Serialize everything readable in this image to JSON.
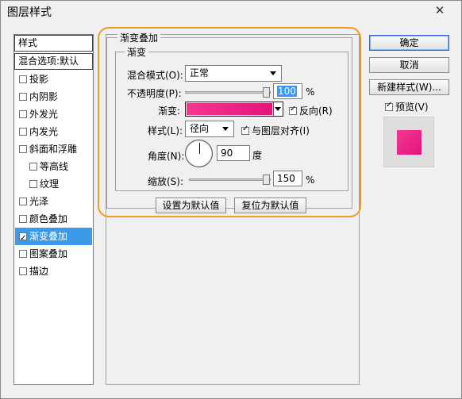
{
  "window": {
    "title": "图层样式",
    "close_glyph": "✕"
  },
  "sidebar": {
    "header": "样式",
    "blend_options": "混合选项:默认",
    "items": [
      {
        "label": "投影",
        "checked": false,
        "indent": false,
        "selected": false
      },
      {
        "label": "内阴影",
        "checked": false,
        "indent": false,
        "selected": false
      },
      {
        "label": "外发光",
        "checked": false,
        "indent": false,
        "selected": false
      },
      {
        "label": "内发光",
        "checked": false,
        "indent": false,
        "selected": false
      },
      {
        "label": "斜面和浮雕",
        "checked": false,
        "indent": false,
        "selected": false
      },
      {
        "label": "等高线",
        "checked": false,
        "indent": true,
        "selected": false
      },
      {
        "label": "纹理",
        "checked": false,
        "indent": true,
        "selected": false
      },
      {
        "label": "光泽",
        "checked": false,
        "indent": false,
        "selected": false
      },
      {
        "label": "颜色叠加",
        "checked": false,
        "indent": false,
        "selected": false
      },
      {
        "label": "渐变叠加",
        "checked": true,
        "indent": false,
        "selected": true
      },
      {
        "label": "图案叠加",
        "checked": false,
        "indent": false,
        "selected": false
      },
      {
        "label": "描边",
        "checked": false,
        "indent": false,
        "selected": false
      }
    ]
  },
  "panel": {
    "group_title": "渐变叠加",
    "subgroup_title": "渐变",
    "blend_mode_label": "混合模式(O):",
    "blend_mode_value": "正常",
    "opacity_label": "不透明度(P):",
    "opacity_value": "100",
    "opacity_fraction": 1.0,
    "percent": "%",
    "gradient_label": "渐变:",
    "reverse_label": "反向(R)",
    "reverse_checked": true,
    "style_label": "样式(L):",
    "style_value": "径向",
    "align_label": "与图层对齐(I)",
    "align_checked": true,
    "angle_label": "角度(N):",
    "angle_value": "90",
    "angle_unit": "度",
    "scale_label": "缩放(S):",
    "scale_value": "150",
    "scale_fraction": 1.0,
    "set_default": "设置为默认值",
    "reset_default": "复位为默认值"
  },
  "actions": {
    "ok": "确定",
    "cancel": "取消",
    "new_style": "新建样式(W)...",
    "preview_label": "预览(V)",
    "preview_checked": true
  },
  "colors": {
    "gradient_start": "#f5378f",
    "gradient_end": "#e3147c",
    "selection": "#3c9ae8",
    "highlight": "#f39a20"
  },
  "icons": {
    "close": "close-icon",
    "dropdown": "chevron-down-icon",
    "check": "check-icon"
  }
}
